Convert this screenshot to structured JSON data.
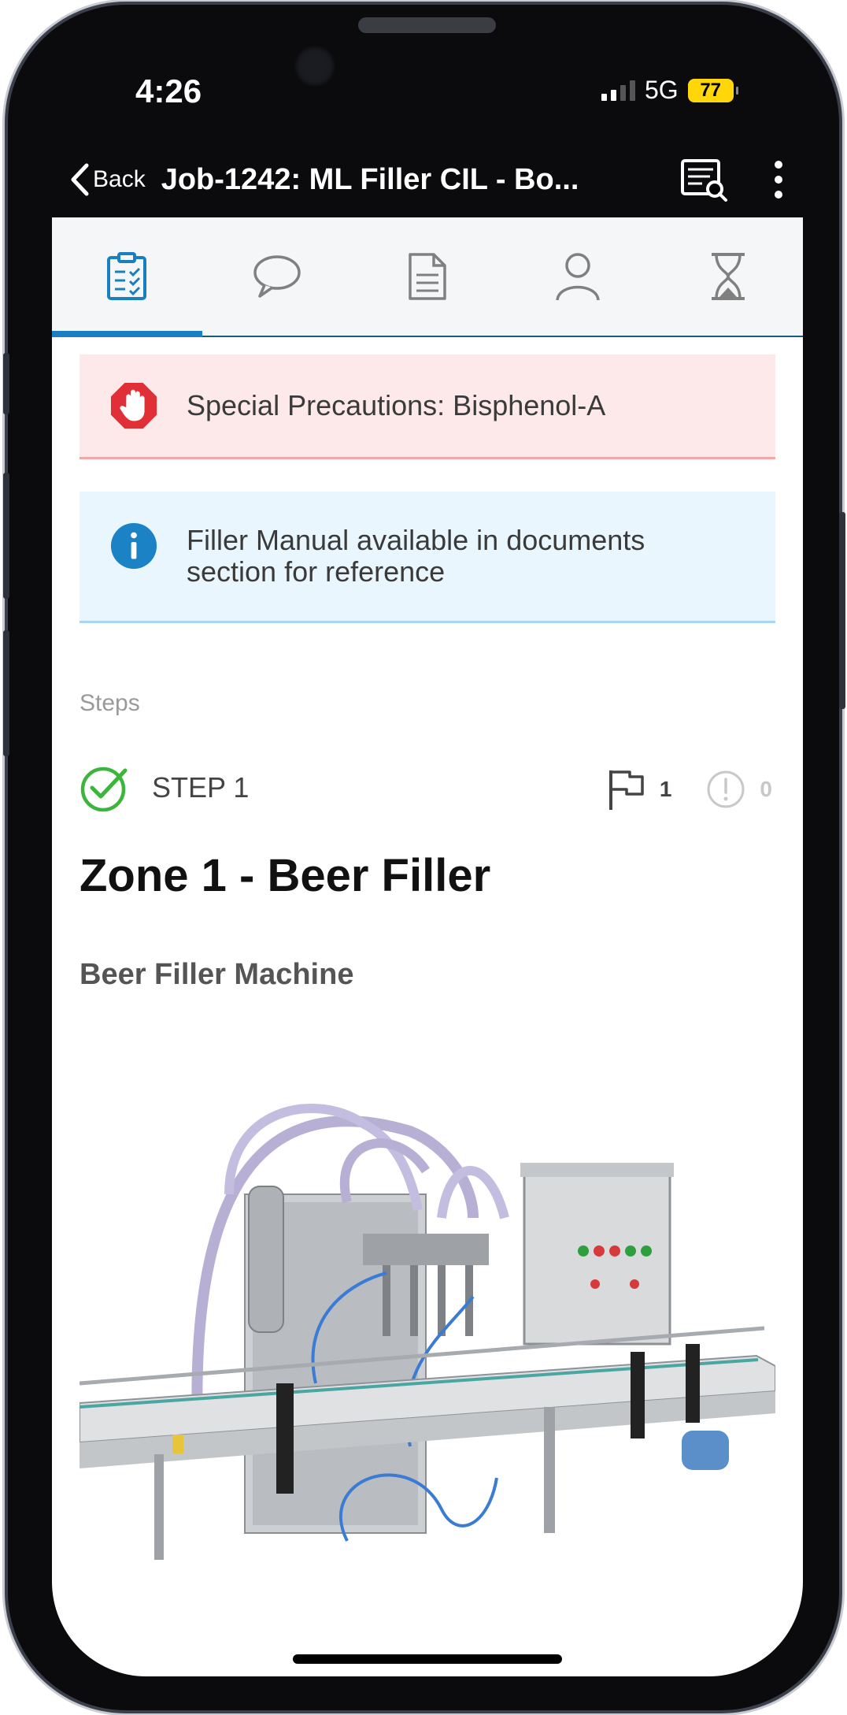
{
  "status_bar": {
    "time": "4:26",
    "network": "5G",
    "battery": "77"
  },
  "nav": {
    "back_label": "Back",
    "title": "Job-1242: ML Filler CIL - Bo...",
    "actions": [
      "report-search-icon",
      "more-vertical-icon"
    ]
  },
  "tabs": [
    {
      "icon": "checklist-icon",
      "active": true
    },
    {
      "icon": "comment-icon",
      "active": false
    },
    {
      "icon": "document-icon",
      "active": false
    },
    {
      "icon": "person-icon",
      "active": false
    },
    {
      "icon": "hourglass-icon",
      "active": false
    }
  ],
  "banners": {
    "precaution": {
      "icon": "stop-hand-icon",
      "text": "Special Precautions: Bisphenol-A",
      "color": "#e02f36"
    },
    "info": {
      "icon": "info-icon",
      "text": "Filler Manual available in documents section for reference",
      "color": "#1b82c6"
    }
  },
  "steps": {
    "section_label": "Steps",
    "step": {
      "label": "STEP 1",
      "status_icon": "check-circle-icon",
      "flag_count": "1",
      "issue_count": "0",
      "title": "Zone 1 - Beer Filler",
      "subtitle": "Beer Filler Machine",
      "image": "beer-filler-machine-photo"
    }
  },
  "colors": {
    "accent": "#1a7fc1",
    "success": "#3bb53b"
  }
}
